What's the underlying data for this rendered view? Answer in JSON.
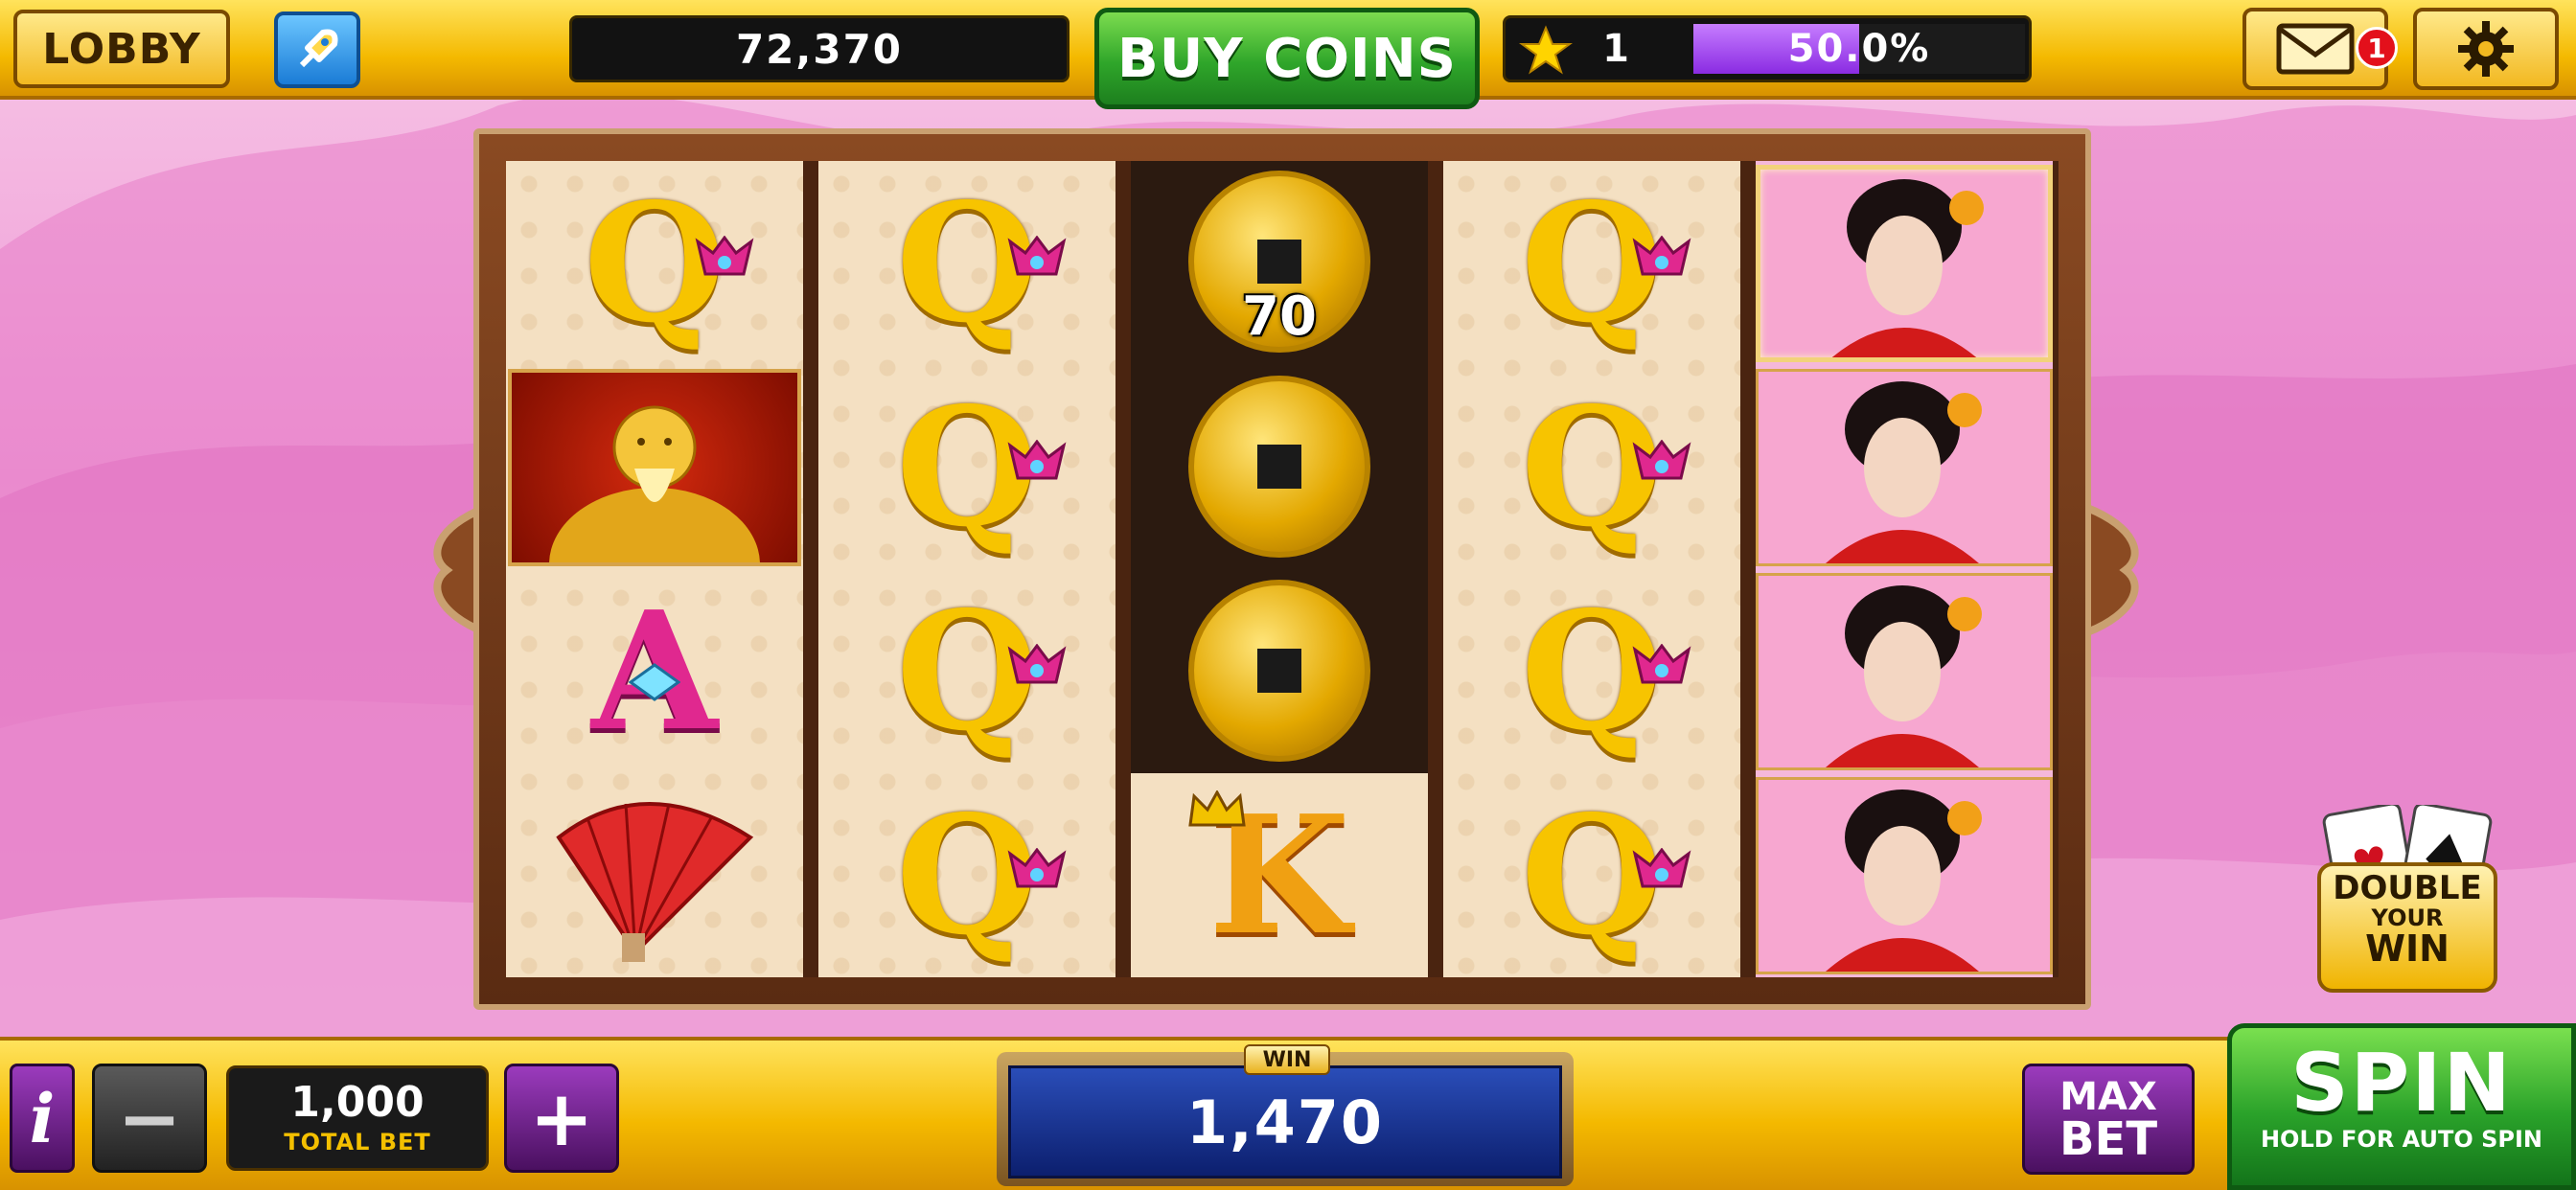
{
  "topbar": {
    "lobby_label": "LOBBY",
    "coins": "72,370",
    "buy_coins_label": "BUY COINS",
    "level": "1",
    "xp_percent_text": "50.0%",
    "xp_fraction": 0.5,
    "mail_badge_count": "1"
  },
  "reels": {
    "coin_value": "70",
    "symbols": [
      [
        "Q",
        "sage",
        "A",
        "fan"
      ],
      [
        "Q",
        "Q",
        "Q",
        "Q"
      ],
      [
        "coin",
        "coin",
        "coin",
        "K"
      ],
      [
        "Q",
        "Q",
        "Q",
        "Q"
      ],
      [
        "geisha",
        "geisha",
        "geisha",
        "geisha"
      ]
    ]
  },
  "double_win": {
    "line1": "DOUBLE",
    "line2": "YOUR",
    "line3": "WIN"
  },
  "bottombar": {
    "info_label": "i",
    "minus_label": "−",
    "total_bet_value": "1,000",
    "total_bet_label": "TOTAL BET",
    "plus_label": "+",
    "win_label": "WIN",
    "win_value": "1,470",
    "max_bet_line1": "MAX",
    "max_bet_line2": "BET",
    "spin_label": "SPIN",
    "spin_sub": "HOLD FOR AUTO SPIN"
  },
  "colors": {
    "accent_gold": "#f4b900",
    "buy_green": "#2fa62a",
    "purple": "#8a2be2",
    "background_pink": "#ee98d6"
  },
  "icons": [
    "rocket-icon",
    "star-icon",
    "mail-icon",
    "gear-icon"
  ]
}
